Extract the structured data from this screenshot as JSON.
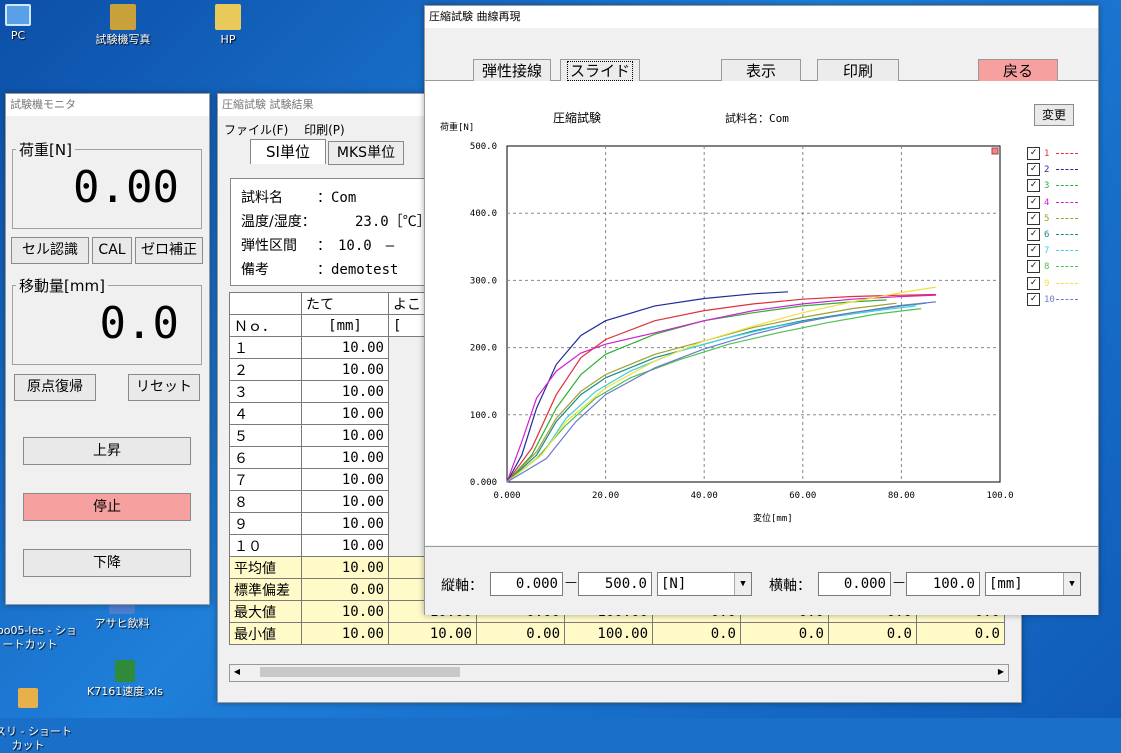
{
  "desktop": {
    "icons": [
      {
        "label": "PC",
        "color": "#5aa0e6"
      },
      {
        "label": "試験機写真",
        "color": "#c9a13a"
      },
      {
        "label": "HP",
        "color": "#e8c95a"
      },
      {
        "label": "oo05-les - ショ\nートカット",
        "color": "#4a7ed0"
      },
      {
        "label": "アサヒ飲料",
        "color": "#4a7ed0"
      },
      {
        "label": "スリ - ショート\nカット",
        "color": "#e8b04a"
      },
      {
        "label": "K7161速度.xls",
        "color": "#2e8b3a"
      }
    ]
  },
  "monitor": {
    "title": "試験機モニタ",
    "load_label": "荷重[N]",
    "load_value": "0.00",
    "btn_cell": "セル認識",
    "btn_cal": "CAL",
    "btn_zero": "ゼロ補正",
    "move_label": "移動量[mm]",
    "move_value": "0.0",
    "btn_origin": "原点復帰",
    "btn_reset": "リセット",
    "btn_up": "上昇",
    "btn_stop": "停止",
    "btn_down": "下降",
    "stop_color": "#f7a0a0"
  },
  "results": {
    "title": "圧縮試験 試験結果",
    "menu": [
      "ファイル(F)",
      "印刷(P)"
    ],
    "tabs": [
      "SI単位",
      "MKS単位"
    ],
    "info": {
      "name_label": "試料名",
      "name_value": "：Com",
      "temp_label": "温度/湿度：",
      "temp_value": "23.0［℃］",
      "range_label": "弾性区間",
      "range_value": "：　10.0　—",
      "note_label": "備考",
      "note_value": "：demotest"
    },
    "col_headers": [
      "たて",
      "よこ"
    ],
    "unit_row": [
      "Ｎｏ．",
      "[mm]",
      "["
    ],
    "rows": [
      {
        "no": "１",
        "v": "10.00"
      },
      {
        "no": "２",
        "v": "10.00"
      },
      {
        "no": "３",
        "v": "10.00"
      },
      {
        "no": "４",
        "v": "10.00"
      },
      {
        "no": "５",
        "v": "10.00"
      },
      {
        "no": "６",
        "v": "10.00"
      },
      {
        "no": "７",
        "v": "10.00"
      },
      {
        "no": "８",
        "v": "10.00"
      },
      {
        "no": "９",
        "v": "10.00"
      },
      {
        "no": "１０",
        "v": "10.00"
      }
    ],
    "stats": [
      {
        "label": "平均値",
        "vals": [
          "10.00"
        ]
      },
      {
        "label": "標準偏差",
        "vals": [
          "0.00"
        ]
      },
      {
        "label": "最大値",
        "vals": [
          "10.00",
          "10.00",
          "0.00",
          "100.00",
          "0.0",
          "0.0",
          "0.0",
          "0.0"
        ]
      },
      {
        "label": "最小値",
        "vals": [
          "10.00",
          "10.00",
          "0.00",
          "100.00",
          "0.0",
          "0.0",
          "0.0",
          "0.0"
        ]
      }
    ]
  },
  "curve": {
    "title": "圧縮試験 曲線再現",
    "toolbar": {
      "elastic": "弾性接線",
      "slide": "スライド",
      "show": "表示",
      "print": "印刷",
      "back": "戻る",
      "back_color": "#f7a0a0"
    },
    "chart_header": "圧縮試験",
    "sample_label": "試料名：Com",
    "change_btn": "変更",
    "y_axis_label": "荷重[N]",
    "x_axis_label": "変位[mm]",
    "bottom": {
      "v_label": "縦軸：",
      "v_min": "0.000",
      "v_max": "500.0",
      "v_unit": "[N]",
      "h_label": "横軸：",
      "h_min": "0.000",
      "h_max": "100.0",
      "h_unit": "[mm]",
      "dash": "—"
    }
  },
  "chart_data": {
    "type": "line",
    "title": "",
    "xlabel": "変位[mm]",
    "ylabel": "荷重[N]",
    "xlim": [
      0,
      100
    ],
    "ylim": [
      0,
      500
    ],
    "x_ticks": [
      "0.000",
      "20.00",
      "40.00",
      "60.00",
      "80.00",
      "100.0"
    ],
    "y_ticks": [
      "0.000",
      "100.0",
      "200.0",
      "300.0",
      "400.0",
      "500.0"
    ],
    "grid": true,
    "legend_position": "right",
    "series": [
      {
        "name": "1",
        "color": "#e0303a",
        "points": [
          [
            0,
            0
          ],
          [
            5,
            50
          ],
          [
            10,
            130
          ],
          [
            15,
            185
          ],
          [
            20,
            212
          ],
          [
            30,
            240
          ],
          [
            40,
            255
          ],
          [
            50,
            265
          ],
          [
            60,
            272
          ],
          [
            70,
            276
          ],
          [
            80,
            278
          ],
          [
            87,
            279
          ]
        ]
      },
      {
        "name": "2",
        "color": "#202a9a",
        "points": [
          [
            0,
            0
          ],
          [
            3,
            40
          ],
          [
            6,
            110
          ],
          [
            10,
            175
          ],
          [
            15,
            218
          ],
          [
            20,
            240
          ],
          [
            30,
            262
          ],
          [
            40,
            273
          ],
          [
            50,
            280
          ],
          [
            57,
            283
          ]
        ]
      },
      {
        "name": "3",
        "color": "#30b030",
        "points": [
          [
            0,
            0
          ],
          [
            5,
            40
          ],
          [
            10,
            110
          ],
          [
            15,
            160
          ],
          [
            20,
            190
          ],
          [
            30,
            220
          ],
          [
            40,
            240
          ],
          [
            50,
            252
          ],
          [
            60,
            262
          ],
          [
            70,
            268
          ],
          [
            77,
            271
          ]
        ]
      },
      {
        "name": "4",
        "color": "#d020d0",
        "points": [
          [
            0,
            0
          ],
          [
            3,
            60
          ],
          [
            6,
            125
          ],
          [
            10,
            165
          ],
          [
            15,
            192
          ],
          [
            20,
            205
          ],
          [
            30,
            222
          ],
          [
            40,
            240
          ],
          [
            50,
            255
          ],
          [
            60,
            265
          ],
          [
            70,
            272
          ],
          [
            80,
            276
          ],
          [
            87,
            278
          ]
        ]
      },
      {
        "name": "5",
        "color": "#a0a030",
        "points": [
          [
            0,
            0
          ],
          [
            6,
            45
          ],
          [
            10,
            95
          ],
          [
            15,
            135
          ],
          [
            20,
            160
          ],
          [
            30,
            190
          ],
          [
            40,
            210
          ],
          [
            50,
            230
          ],
          [
            60,
            245
          ],
          [
            70,
            258
          ],
          [
            79,
            266
          ]
        ]
      },
      {
        "name": "6",
        "color": "#1a8a8a",
        "points": [
          [
            0,
            0
          ],
          [
            6,
            40
          ],
          [
            10,
            90
          ],
          [
            15,
            130
          ],
          [
            20,
            155
          ],
          [
            30,
            185
          ],
          [
            40,
            205
          ],
          [
            50,
            225
          ],
          [
            60,
            240
          ],
          [
            70,
            252
          ],
          [
            80,
            262
          ],
          [
            85,
            266
          ]
        ]
      },
      {
        "name": "7",
        "color": "#40d0e0",
        "points": [
          [
            0,
            0
          ],
          [
            7,
            40
          ],
          [
            12,
            95
          ],
          [
            18,
            135
          ],
          [
            25,
            165
          ],
          [
            35,
            195
          ],
          [
            45,
            215
          ],
          [
            55,
            232
          ],
          [
            65,
            245
          ],
          [
            75,
            255
          ],
          [
            83,
            262
          ]
        ]
      },
      {
        "name": "8",
        "color": "#50c050",
        "points": [
          [
            0,
            0
          ],
          [
            6,
            35
          ],
          [
            12,
            85
          ],
          [
            18,
            125
          ],
          [
            25,
            155
          ],
          [
            35,
            182
          ],
          [
            45,
            205
          ],
          [
            55,
            222
          ],
          [
            65,
            237
          ],
          [
            75,
            250
          ],
          [
            84,
            258
          ]
        ]
      },
      {
        "name": "9",
        "color": "#f0e040",
        "points": [
          [
            0,
            0
          ],
          [
            7,
            40
          ],
          [
            12,
            90
          ],
          [
            20,
            140
          ],
          [
            30,
            180
          ],
          [
            40,
            210
          ],
          [
            50,
            232
          ],
          [
            60,
            252
          ],
          [
            70,
            268
          ],
          [
            80,
            282
          ],
          [
            87,
            290
          ]
        ]
      },
      {
        "name": "10",
        "color": "#6a7ad0",
        "points": [
          [
            0,
            0
          ],
          [
            8,
            35
          ],
          [
            14,
            90
          ],
          [
            20,
            130
          ],
          [
            30,
            170
          ],
          [
            40,
            198
          ],
          [
            50,
            220
          ],
          [
            60,
            238
          ],
          [
            70,
            252
          ],
          [
            80,
            263
          ],
          [
            87,
            268
          ]
        ]
      }
    ]
  }
}
